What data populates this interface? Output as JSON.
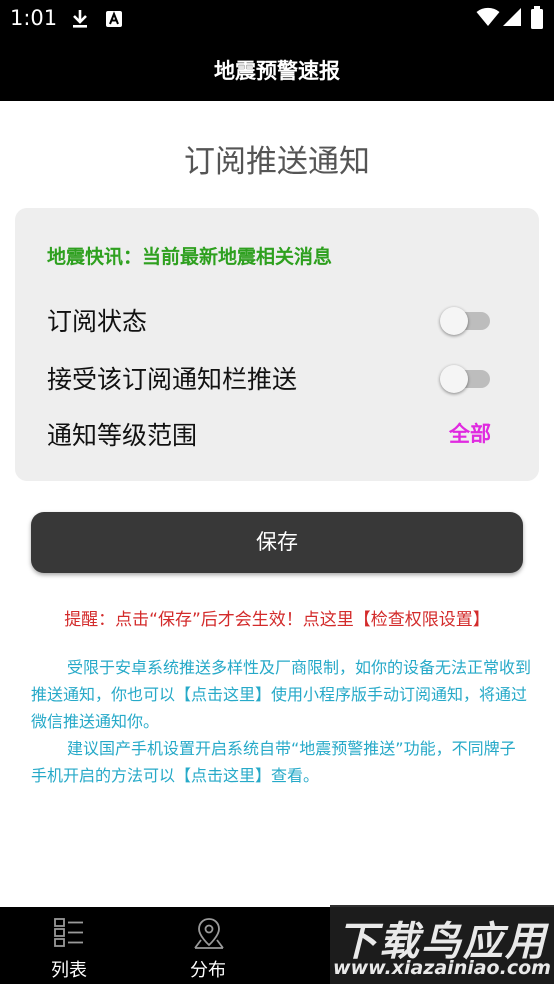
{
  "status_bar": {
    "time": "1:01"
  },
  "app_bar": {
    "title": "地震预警速报"
  },
  "page": {
    "heading": "订阅推送通知"
  },
  "card": {
    "flash_news": "地震快讯：当前最新地震相关消息",
    "subscription_status_label": "订阅状态",
    "subscription_status_on": false,
    "notification_bar_label": "接受该订阅通知栏推送",
    "notification_bar_on": false,
    "level_range_label": "通知等级范围",
    "level_range_value": "全部"
  },
  "save_button_label": "保存",
  "reminder": "提醒：点击“保存”后才会生效！点这里【检查权限设置】",
  "info": {
    "paragraph1": "受限于安卓系统推送多样性及厂商限制，如你的设备无法正常收到推送通知，你也可以【点击这里】使用小程序版手动订阅通知，将通过微信推送通知你。",
    "paragraph2": "建议国产手机设置开启系统自带“地震预警推送”功能，不同牌子手机开启的方法可以【点击这里】查看。"
  },
  "bottom_nav": {
    "items": [
      {
        "label": "列表",
        "icon": "list-icon"
      },
      {
        "label": "分布",
        "icon": "map-pin-icon"
      }
    ]
  },
  "watermark": {
    "brand": "下载鸟应用",
    "url": "www.xiazainiao.com"
  },
  "colors": {
    "bar_background": "#000000",
    "flash_green": "#2ea01f",
    "level_magenta": "#e02ae0",
    "reminder_red": "#d32b2b",
    "info_cyan": "#26a9c8",
    "save_button": "#383838"
  }
}
